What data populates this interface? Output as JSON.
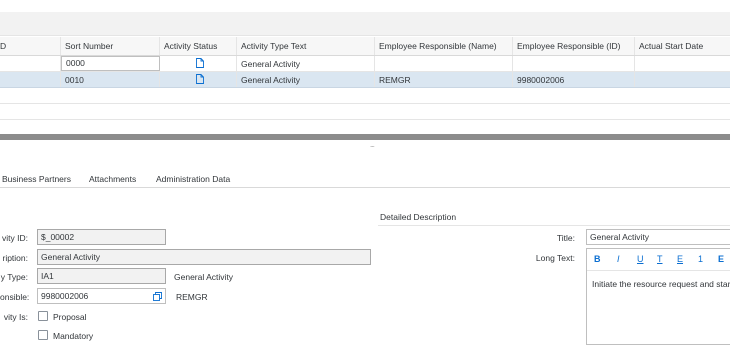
{
  "table": {
    "columns": [
      "D",
      "Sort Number",
      "Activity Status",
      "Activity Type Text",
      "Employee Responsible (Name)",
      "Employee Responsible (ID)",
      "Actual Start Date"
    ],
    "rows": [
      {
        "sort": "0000",
        "status_icon": "document-icon",
        "type_text": "General Activity",
        "emp_name": "",
        "emp_id": "",
        "start": ""
      },
      {
        "sort": "0010",
        "status_icon": "document-icon",
        "type_text": "General Activity",
        "emp_name": "REMGR",
        "emp_id": "9980002006",
        "start": ""
      }
    ]
  },
  "splitter_grip": "....",
  "tabs": [
    "Business Partners",
    "Attachments",
    "Administration Data"
  ],
  "form": {
    "activity_id_label": "vity ID:",
    "activity_id_value": "$_00002",
    "description_label": "ription:",
    "description_value": "General Activity",
    "type_label": "y Type:",
    "type_value": "IA1",
    "type_text": "General Activity",
    "responsible_label": "onsible:",
    "responsible_value": "9980002006",
    "responsible_name": "REMGR",
    "activity_is_label": "vity Is:",
    "proposal_label": "Proposal",
    "mandatory_label": "Mandatory"
  },
  "detail": {
    "section_title": "Detailed Description",
    "title_label": "Title:",
    "title_value": "General Activity",
    "long_text_label": "Long Text:",
    "long_text_value": "Initiate the resource request and star",
    "toolbar": [
      "B",
      "I",
      "U",
      "T",
      "E",
      "1",
      "E"
    ]
  },
  "colors": {
    "accent": "#0a6ed1",
    "selected_row": "#dae6f1",
    "splitter": "#8c8c8c"
  }
}
